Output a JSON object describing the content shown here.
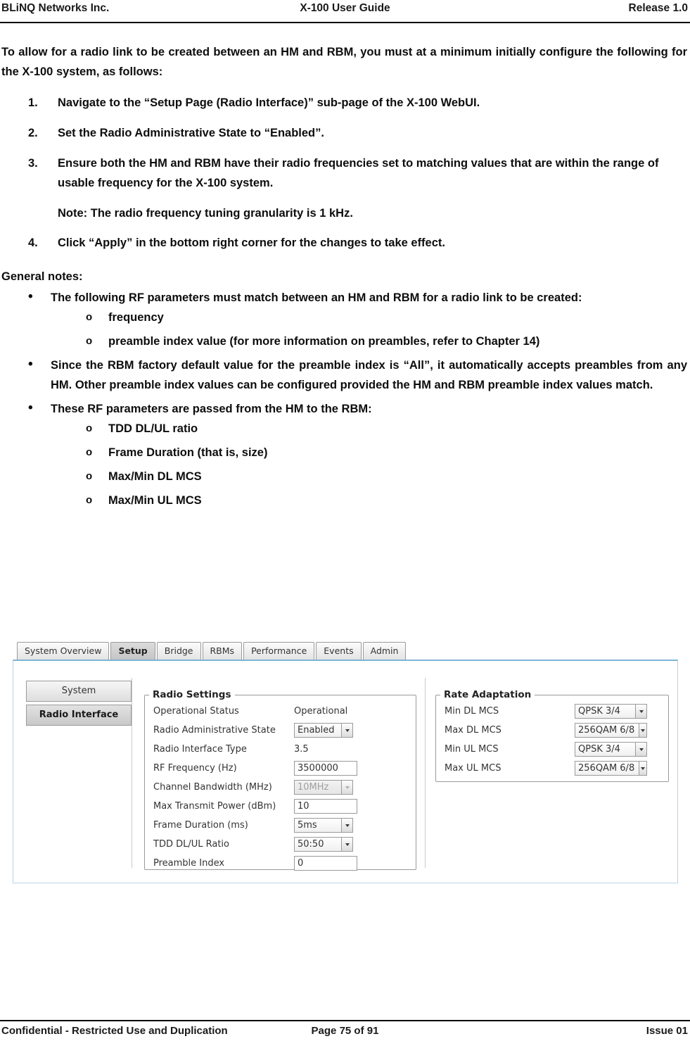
{
  "header": {
    "left": "BLiNQ Networks Inc.",
    "center": "X-100 User Guide",
    "right": "Release 1.0"
  },
  "intro": "To allow for a radio link to be created between an HM and RBM, you must at a minimum initially configure the following for the X-100 system, as follows:",
  "steps": [
    {
      "num": "1.",
      "text": "Navigate to the “Setup Page (Radio Interface)” sub-page of the X-100 WebUI."
    },
    {
      "num": "2.",
      "text": "Set the Radio Administrative State to “Enabled”."
    },
    {
      "num": "3.",
      "text": "Ensure both the HM and RBM have their radio frequencies set to matching values that are within the range of usable frequency for the X-100 system."
    }
  ],
  "note": {
    "label": "Note:",
    "text": " The radio frequency tuning granularity is 1 kHz."
  },
  "step4": {
    "num": "4.",
    "text": "Click “Apply” in the bottom right corner for the changes to take effect."
  },
  "general_notes_label": "General notes:",
  "bullets": [
    {
      "text": "The following RF parameters must match between an HM and RBM for a radio link to be created:",
      "sub": [
        "frequency",
        "preamble index value (for more information on preambles, refer to Chapter 14)"
      ]
    },
    {
      "text": "Since the RBM factory default value for the preamble index is “All”, it automatically accepts preambles from any HM. Other preamble index values can be configured provided the HM and RBM preamble index values match.",
      "sub": []
    },
    {
      "text": "These RF parameters are passed from the HM to the RBM:",
      "sub": [
        "TDD DL/UL ratio",
        "Frame Duration (that is, size)",
        "Max/Min DL MCS",
        "Max/Min UL MCS"
      ]
    }
  ],
  "screenshot": {
    "tabs": [
      {
        "label": "System Overview",
        "active": false
      },
      {
        "label": "Setup",
        "active": true
      },
      {
        "label": "Bridge",
        "active": false
      },
      {
        "label": "RBMs",
        "active": false
      },
      {
        "label": "Performance",
        "active": false
      },
      {
        "label": "Events",
        "active": false
      },
      {
        "label": "Admin",
        "active": false
      }
    ],
    "leftnav": [
      {
        "label": "System",
        "selected": false
      },
      {
        "label": "Radio Interface",
        "selected": true
      }
    ],
    "radio_settings": {
      "legend": "Radio Settings",
      "rows": [
        {
          "label": "Operational Status",
          "value": "Operational",
          "type": "text"
        },
        {
          "label": "Radio Administrative State",
          "value": "Enabled",
          "type": "select"
        },
        {
          "label": "Radio Interface Type",
          "value": "3.5",
          "type": "text"
        },
        {
          "label": "RF Frequency (Hz)",
          "value": "3500000",
          "type": "input"
        },
        {
          "label": "Channel Bandwidth (MHz)",
          "value": "10MHz",
          "type": "select-disabled"
        },
        {
          "label": "Max Transmit Power (dBm)",
          "value": "10",
          "type": "input"
        },
        {
          "label": "Frame Duration (ms)",
          "value": "5ms",
          "type": "select"
        },
        {
          "label": "TDD DL/UL Ratio",
          "value": "50:50",
          "type": "select"
        },
        {
          "label": "Preamble Index",
          "value": "0",
          "type": "input"
        }
      ]
    },
    "rate_adaptation": {
      "legend": "Rate Adaptation",
      "rows": [
        {
          "label": "Min DL MCS",
          "value": "QPSK 3/4",
          "type": "select"
        },
        {
          "label": "Max DL MCS",
          "value": "256QAM 6/8",
          "type": "select"
        },
        {
          "label": "Min UL MCS",
          "value": "QPSK 3/4",
          "type": "select"
        },
        {
          "label": "Max UL MCS",
          "value": "256QAM 6/8",
          "type": "select"
        }
      ]
    }
  },
  "footer": {
    "left": "Confidential - Restricted Use and Duplication",
    "center": "Page 75 of 91",
    "right": "Issue 01"
  }
}
